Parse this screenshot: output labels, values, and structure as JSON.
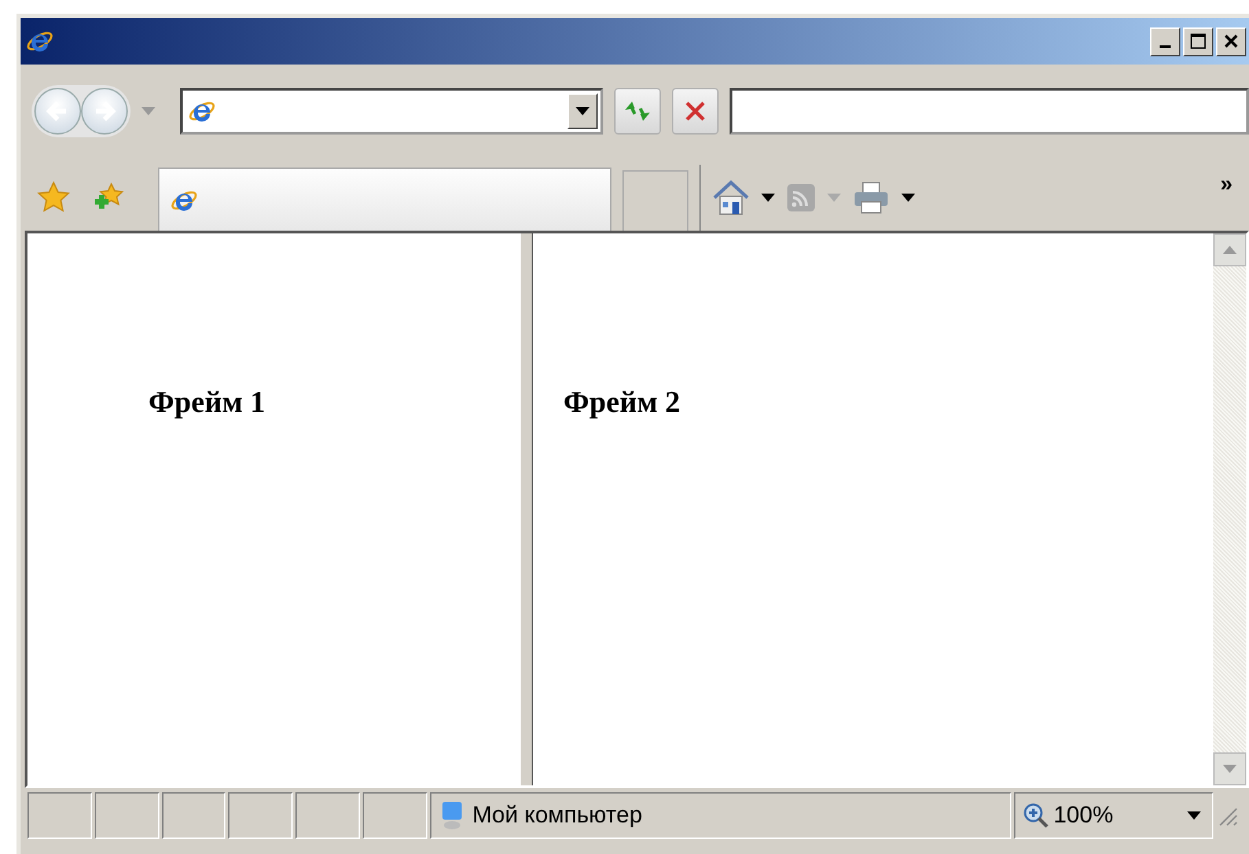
{
  "toolbar": {
    "overflow": "»"
  },
  "frames": [
    {
      "heading": "Фрейм 1"
    },
    {
      "heading": "Фрейм 2"
    }
  ],
  "status_bar": {
    "zone": "Мой компьютер",
    "zoom": "100%"
  }
}
